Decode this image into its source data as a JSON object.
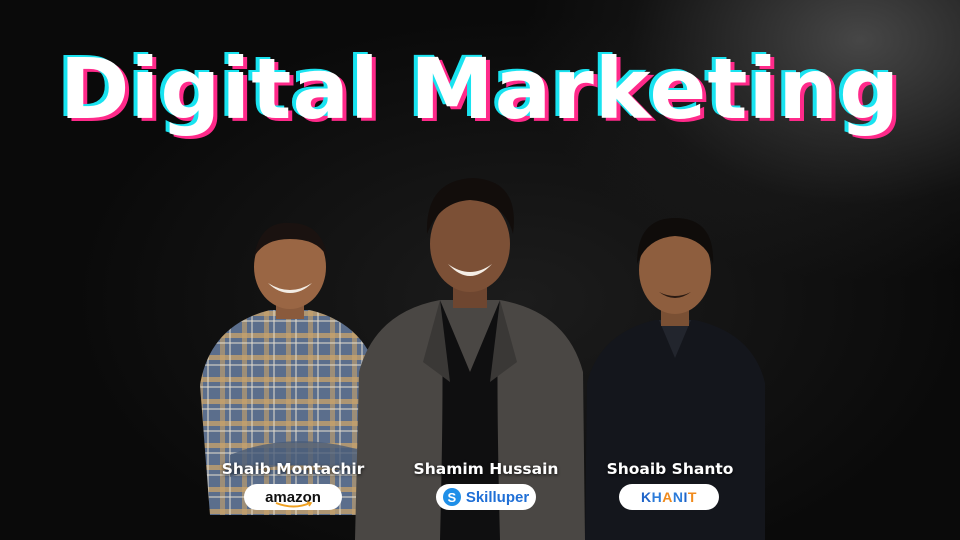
{
  "title": "Digital Marketing",
  "people": [
    {
      "name": "Shaib Montachir",
      "company": "amazon"
    },
    {
      "name": "Shamim Hussain",
      "company": "Skilluper"
    },
    {
      "name": "Shoaib Shanto",
      "company": "KHANIT"
    }
  ],
  "colors": {
    "title_fill": "#ffffff",
    "title_shadow_cyan": "#19e3f0",
    "title_shadow_magenta": "#ff2a8a",
    "background": "#0a0a0a"
  },
  "icons": [
    "amazon-logo",
    "skilluper-logo",
    "khanit-logo"
  ]
}
